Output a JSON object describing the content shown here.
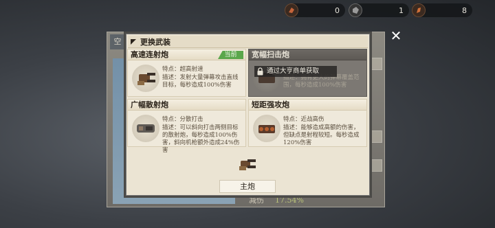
{
  "resources": [
    {
      "icon": "red-crystal-icon",
      "value": "0"
    },
    {
      "icon": "gray-ore-icon",
      "value": "1"
    },
    {
      "icon": "copper-part-icon",
      "value": "8"
    }
  ],
  "background": {
    "side_tab": "空",
    "reduce_label": "减伤",
    "reduce_value": "17.54%"
  },
  "dialog": {
    "title": "更换武装",
    "close_icon": "close-icon",
    "cards": [
      {
        "title": "高速连射炮",
        "badge": "当前",
        "lines": [
          "特点：超高射速",
          "描述：发射大量弹幕攻击直线目标，每秒造成100%伤害"
        ]
      },
      {
        "title": "宽幅扫击炮",
        "lock_text": "通过大亨商单获取",
        "lines": [
          "描述：拥有更大的弹幕覆盖范围，每秒造成100%伤害"
        ]
      },
      {
        "title": "广幅散射炮",
        "lines": [
          "特点：分散打击",
          "描述：可以斜向打击两侧目标的散射炮，每秒造成100%伤害，斜向机枪额外造成24%伤害"
        ]
      },
      {
        "title": "短距强攻炮",
        "lines": [
          "特点：近战高伤",
          "描述：能够造成高额的伤害，但缺点是射程较短。每秒造成120%伤害"
        ]
      }
    ],
    "slot_label": "主炮"
  },
  "colors": {
    "badge_green": "#5aa74b",
    "panel_bg": "#ebe4d3",
    "locked_bg": "#7c7873"
  }
}
